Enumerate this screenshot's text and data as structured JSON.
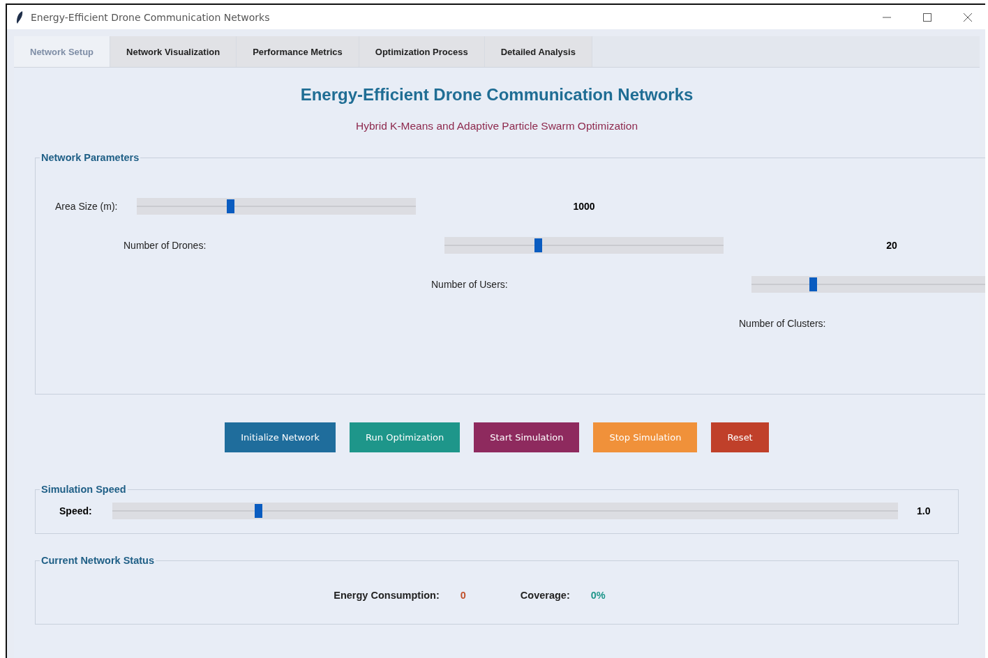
{
  "window": {
    "title": "Energy-Efficient Drone Communication Networks"
  },
  "tabs": [
    {
      "label": "Network Setup",
      "selected": true
    },
    {
      "label": "Network Visualization",
      "selected": false
    },
    {
      "label": "Performance Metrics",
      "selected": false
    },
    {
      "label": "Optimization Process",
      "selected": false
    },
    {
      "label": "Detailed Analysis",
      "selected": false
    }
  ],
  "heading": "Energy-Efficient Drone Communication Networks",
  "subheading": "Hybrid K-Means and Adaptive Particle Swarm Optimization",
  "network_parameters": {
    "title": "Network Parameters",
    "rows": [
      {
        "label": "Area Size (m):",
        "level": 0.335,
        "value": "1000"
      },
      {
        "label": "Number of Drones:",
        "level": 0.335,
        "value": "20"
      },
      {
        "label": "Number of Users:",
        "level": 0.22
      },
      {
        "label": "Number of Clusters:"
      }
    ]
  },
  "buttons": [
    {
      "label": "Initialize Network",
      "color": "#1f6d9c"
    },
    {
      "label": "Run Optimization",
      "color": "#1e968a"
    },
    {
      "label": "Start Simulation",
      "color": "#8e2a5e"
    },
    {
      "label": "Stop Simulation",
      "color": "#f0913a"
    },
    {
      "label": "Reset",
      "color": "#c0402a"
    }
  ],
  "simulation_speed": {
    "title": "Simulation Speed",
    "label": "Speed:",
    "level": 0.186,
    "value": "1.0"
  },
  "status": {
    "title": "Current Network Status",
    "items": [
      {
        "label": "Energy Consumption:",
        "value": "0",
        "color": "#c0502a"
      },
      {
        "label": "Coverage:",
        "value": "0%",
        "color": "#1e968a"
      }
    ]
  }
}
